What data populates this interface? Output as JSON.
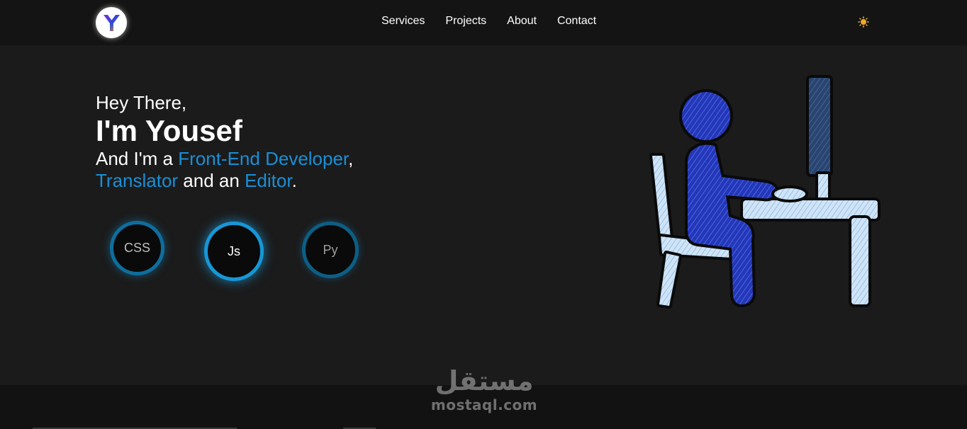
{
  "header": {
    "logo_letter": "Y",
    "nav": [
      "Services",
      "Projects",
      "About",
      "Contact"
    ],
    "theme_toggle_icon": "sun-icon"
  },
  "hero": {
    "greeting": "Hey There,",
    "name": "I'm Yousef",
    "line1_prefix": "And I'm a ",
    "line1_highlight": "Front-End Developer",
    "line1_suffix": ",",
    "line2_highlight1": "Translator",
    "line2_middle": " and an ",
    "line2_highlight2": "Editor",
    "line2_suffix": ".",
    "skills": [
      "CSS",
      "Js",
      "Py"
    ],
    "illustration": "person-at-desk-computer"
  },
  "watermark": {
    "arabic": "مستقل",
    "latin": "mostaql.com"
  },
  "colors": {
    "accent": "#1a8fd6",
    "background": "#1b1b1b",
    "navbar": "#141414",
    "figure": "#2236b8",
    "furniture": "#cfe4f7"
  }
}
